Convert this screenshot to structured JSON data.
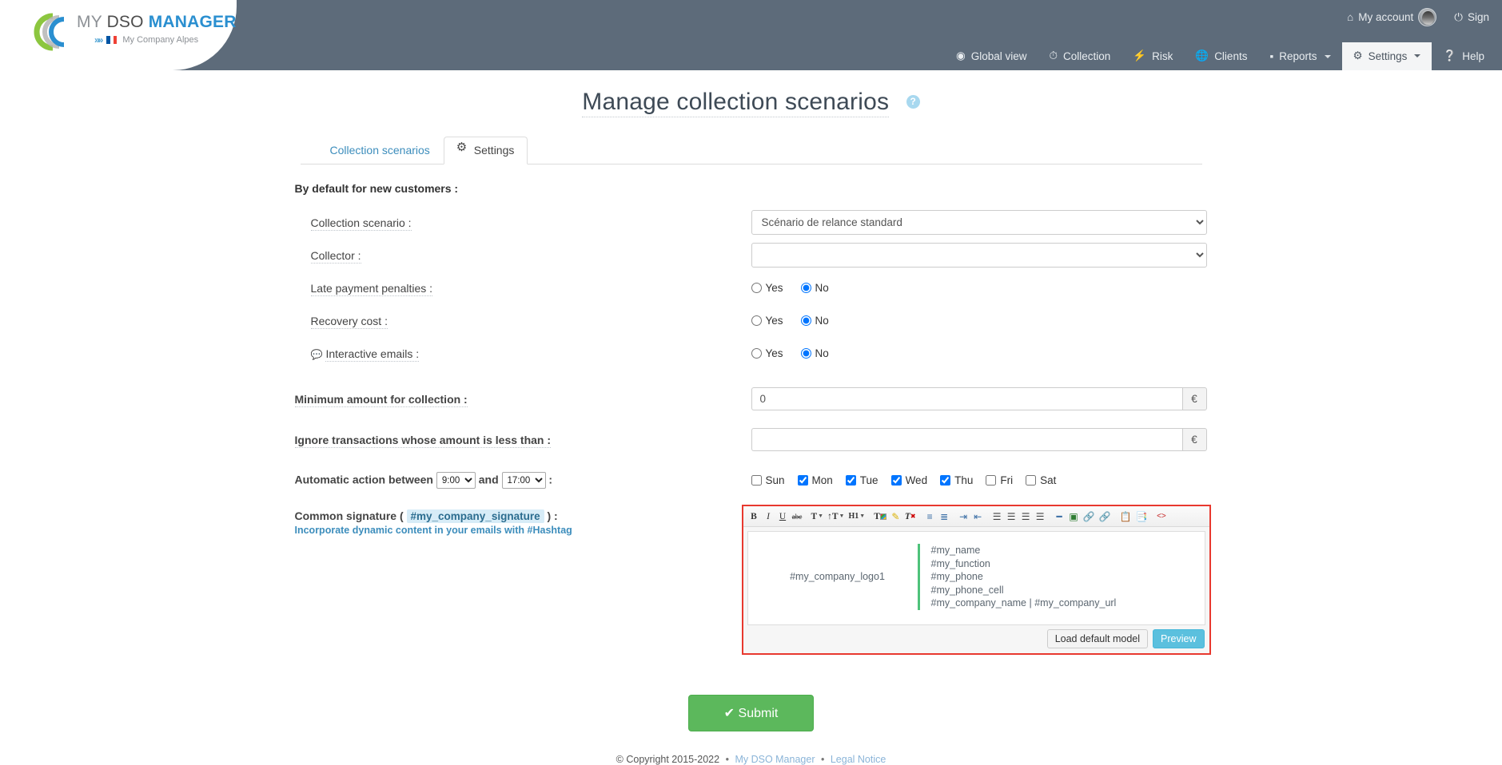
{
  "header": {
    "logo": {
      "my": "MY ",
      "dso": "DSO ",
      "manager": "MANAGER",
      "company": "My Company Alpes",
      "chevrons": "»»"
    },
    "account_label": "My account",
    "signout_label": "Sign",
    "nav": [
      {
        "label": "Global view",
        "icon": "eye-icon",
        "active": false,
        "caret": false
      },
      {
        "label": "Collection",
        "icon": "clock-icon",
        "active": false,
        "caret": false
      },
      {
        "label": "Risk",
        "icon": "bolt-icon",
        "active": false,
        "caret": false
      },
      {
        "label": "Clients",
        "icon": "globe-icon",
        "active": false,
        "caret": false
      },
      {
        "label": "Reports",
        "icon": "bar-chart-icon",
        "active": false,
        "caret": true
      },
      {
        "label": "Settings",
        "icon": "gear-icon",
        "active": true,
        "caret": true
      },
      {
        "label": "Help",
        "icon": "question-circle-icon",
        "active": false,
        "caret": false
      }
    ]
  },
  "page": {
    "title": "Manage collection scenarios",
    "help_badge": "?"
  },
  "tabs": [
    {
      "label": "Collection scenarios",
      "active": false
    },
    {
      "label": "Settings",
      "active": true,
      "icon": "gear-icon"
    }
  ],
  "form": {
    "section_title": "By default for new customers :",
    "collection_scenario": {
      "label": "Collection scenario :",
      "value": "Scénario de relance standard",
      "options": [
        "Scénario de relance standard"
      ]
    },
    "collector": {
      "label": "Collector :",
      "value": "",
      "options": [
        ""
      ]
    },
    "late_payment_penalties": {
      "label": "Late payment penalties :",
      "yes_label": "Yes",
      "no_label": "No",
      "selected": "No"
    },
    "recovery_cost": {
      "label": "Recovery cost :",
      "yes_label": "Yes",
      "no_label": "No",
      "selected": "No"
    },
    "interactive_emails": {
      "label": "Interactive emails :",
      "icon": "comment-icon",
      "yes_label": "Yes",
      "no_label": "No",
      "selected": "No"
    },
    "minimum_amount": {
      "label": "Minimum amount for collection :",
      "value": "0",
      "unit": "€"
    },
    "ignore_transactions": {
      "label": "Ignore transactions whose amount is less than :",
      "value": "",
      "unit": "€"
    },
    "automatic_action": {
      "label_prefix": "Automatic action between",
      "label_middle": "and",
      "label_suffix": ":",
      "from_time": "9:00",
      "to_time": "17:00",
      "from_options": [
        "9:00"
      ],
      "to_options": [
        "17:00"
      ],
      "days": [
        {
          "label": "Sun",
          "checked": false
        },
        {
          "label": "Mon",
          "checked": true
        },
        {
          "label": "Tue",
          "checked": true
        },
        {
          "label": "Wed",
          "checked": true
        },
        {
          "label": "Thu",
          "checked": true
        },
        {
          "label": "Fri",
          "checked": false
        },
        {
          "label": "Sat",
          "checked": false
        }
      ]
    },
    "common_signature": {
      "label_prefix": "Common signature (",
      "hashtag": "#my_company_signature",
      "label_suffix": ") :",
      "hint": "Incorporate dynamic content in your emails with #Hashtag"
    }
  },
  "editor": {
    "toolbar": [
      {
        "name": "bold",
        "glyph": "B",
        "style": "bold"
      },
      {
        "name": "italic",
        "glyph": "I",
        "style": "italic"
      },
      {
        "name": "underline",
        "glyph": "U",
        "style": "underline"
      },
      {
        "name": "strikethrough",
        "glyph": "abc",
        "style": "strike"
      },
      {
        "name": "font-name",
        "glyph": "T",
        "caret": true
      },
      {
        "name": "font-size",
        "glyph": "↑T",
        "caret": true
      },
      {
        "name": "heading",
        "glyph": "H1",
        "caret": true
      },
      {
        "name": "font-color",
        "glyph": "T",
        "swatch": true
      },
      {
        "name": "highlight-color",
        "glyph": "✎",
        "swatch": true
      },
      {
        "name": "remove-format",
        "glyph": "T✕",
        "style": "plain"
      },
      {
        "name": "unordered-list",
        "glyph": "☰"
      },
      {
        "name": "ordered-list",
        "glyph": "☰"
      },
      {
        "name": "indent",
        "glyph": "⇥"
      },
      {
        "name": "outdent",
        "glyph": "⇤"
      },
      {
        "name": "align-left",
        "glyph": "≡"
      },
      {
        "name": "align-center",
        "glyph": "≡"
      },
      {
        "name": "align-right",
        "glyph": "≡"
      },
      {
        "name": "align-justify",
        "glyph": "≡"
      },
      {
        "name": "horizontal-rule",
        "glyph": "—"
      },
      {
        "name": "insert-image",
        "glyph": "▣"
      },
      {
        "name": "insert-link",
        "glyph": "∞"
      },
      {
        "name": "remove-link",
        "glyph": "∞"
      },
      {
        "name": "paste",
        "glyph": "⎘"
      },
      {
        "name": "paste-as-text",
        "glyph": "⎘"
      },
      {
        "name": "source-code",
        "glyph": "<>"
      }
    ],
    "content": {
      "logo_placeholder": "#my_company_logo1",
      "lines": [
        "#my_name",
        "#my_function",
        "#my_phone",
        "#my_phone_cell",
        "#my_company_name | #my_company_url"
      ]
    },
    "load_default_label": "Load default model",
    "preview_label": "Preview",
    "accent_color": "#e8392f",
    "divider_color": "#4ec27a"
  },
  "submit": {
    "label": "Submit",
    "icon": "check-icon",
    "color": "#5cb85c"
  },
  "footer": {
    "copyright": "© Copyright 2015-2022",
    "link1": "My DSO Manager",
    "link2": "Legal Notice",
    "sep": "•"
  }
}
